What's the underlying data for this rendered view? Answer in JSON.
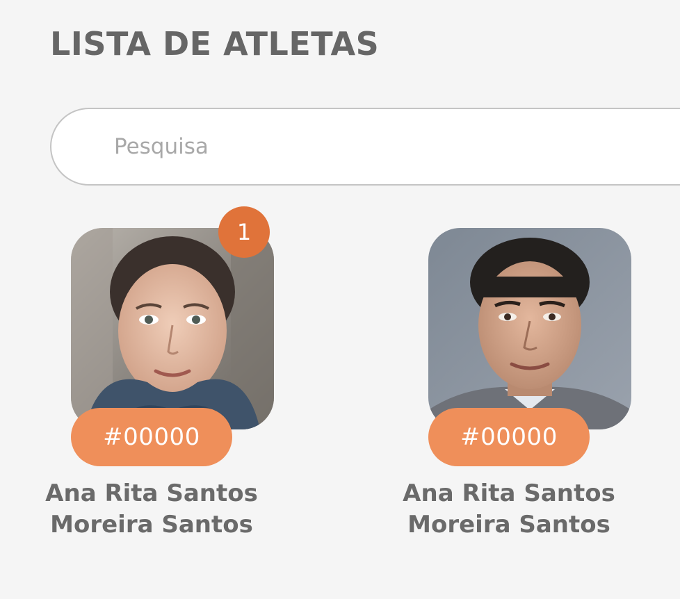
{
  "header": {
    "title": "LISTA DE ATLETAS"
  },
  "search": {
    "placeholder": "Pesquisa",
    "value": ""
  },
  "athletes": [
    {
      "number": "#00000",
      "name_line1": "Ana Rita Santos",
      "name_line2": "Moreira Santos",
      "badge": "1"
    },
    {
      "number": "#00000",
      "name_line1": "Ana Rita Santos",
      "name_line2": "Moreira Santos"
    }
  ],
  "colors": {
    "accent": "#ef8f5a",
    "badge": "#e0733a",
    "title": "#666666",
    "background": "#f5f5f5"
  }
}
